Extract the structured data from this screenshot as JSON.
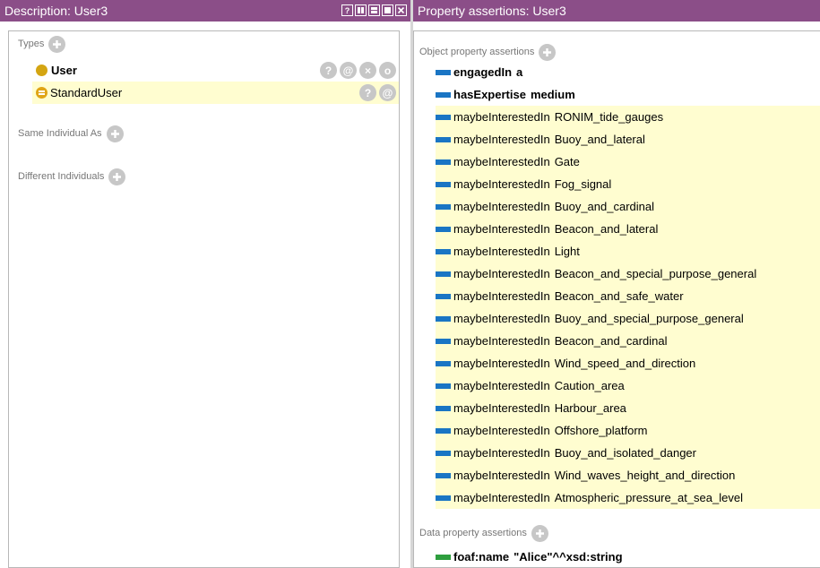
{
  "left_panel": {
    "title": "Description: User3",
    "view_controls": [
      "help-icon",
      "split-vertical-icon",
      "split-horizontal-icon",
      "maximize-icon",
      "close-icon"
    ],
    "types_label": "Types",
    "types": [
      {
        "label": "User",
        "bold": true,
        "icon": "class-icon",
        "actions": [
          "?",
          "@",
          "×",
          "o"
        ]
      },
      {
        "label": "StandardUser",
        "bold": false,
        "icon": "equivalent-class-icon",
        "actions": [
          "?",
          "@"
        ]
      }
    ],
    "same_individual_label": "Same Individual As",
    "different_individuals_label": "Different Individuals"
  },
  "right_panel": {
    "title": "Property assertions: User3",
    "object_section_label": "Object property assertions",
    "object_assertions": [
      {
        "property": "engagedIn",
        "value": "a",
        "bold": true,
        "highlight": false
      },
      {
        "property": "hasExpertise",
        "value": "medium",
        "bold": true,
        "highlight": false
      },
      {
        "property": "maybeInterestedIn",
        "value": "RONIM_tide_gauges",
        "bold": false,
        "highlight": true
      },
      {
        "property": "maybeInterestedIn",
        "value": "Buoy_and_lateral",
        "bold": false,
        "highlight": true
      },
      {
        "property": "maybeInterestedIn",
        "value": "Gate",
        "bold": false,
        "highlight": true
      },
      {
        "property": "maybeInterestedIn",
        "value": "Fog_signal",
        "bold": false,
        "highlight": true
      },
      {
        "property": "maybeInterestedIn",
        "value": "Buoy_and_cardinal",
        "bold": false,
        "highlight": true
      },
      {
        "property": "maybeInterestedIn",
        "value": "Beacon_and_lateral",
        "bold": false,
        "highlight": true
      },
      {
        "property": "maybeInterestedIn",
        "value": "Light",
        "bold": false,
        "highlight": true
      },
      {
        "property": "maybeInterestedIn",
        "value": "Beacon_and_special_purpose_general",
        "bold": false,
        "highlight": true
      },
      {
        "property": "maybeInterestedIn",
        "value": "Beacon_and_safe_water",
        "bold": false,
        "highlight": true
      },
      {
        "property": "maybeInterestedIn",
        "value": "Buoy_and_special_purpose_general",
        "bold": false,
        "highlight": true
      },
      {
        "property": "maybeInterestedIn",
        "value": "Beacon_and_cardinal",
        "bold": false,
        "highlight": true
      },
      {
        "property": "maybeInterestedIn",
        "value": "Wind_speed_and_direction",
        "bold": false,
        "highlight": true
      },
      {
        "property": "maybeInterestedIn",
        "value": "Caution_area",
        "bold": false,
        "highlight": true
      },
      {
        "property": "maybeInterestedIn",
        "value": "Harbour_area",
        "bold": false,
        "highlight": true
      },
      {
        "property": "maybeInterestedIn",
        "value": "Offshore_platform",
        "bold": false,
        "highlight": true
      },
      {
        "property": "maybeInterestedIn",
        "value": "Buoy_and_isolated_danger",
        "bold": false,
        "highlight": true
      },
      {
        "property": "maybeInterestedIn",
        "value": "Wind_waves_height_and_direction",
        "bold": false,
        "highlight": true
      },
      {
        "property": "maybeInterestedIn",
        "value": "Atmospheric_pressure_at_sea_level",
        "bold": false,
        "highlight": true
      }
    ],
    "data_section_label": "Data property assertions",
    "data_assertions": [
      {
        "property": "foaf:name",
        "value": "\"Alice\"^^xsd:string",
        "bold": true
      }
    ]
  },
  "colors": {
    "header": "#8b4e88",
    "inferred_highlight": "#fffdd0",
    "object_property": "#1a75c4",
    "data_property": "#2e9e3e",
    "class": "#d4a512",
    "button": "#c7c7c7"
  }
}
